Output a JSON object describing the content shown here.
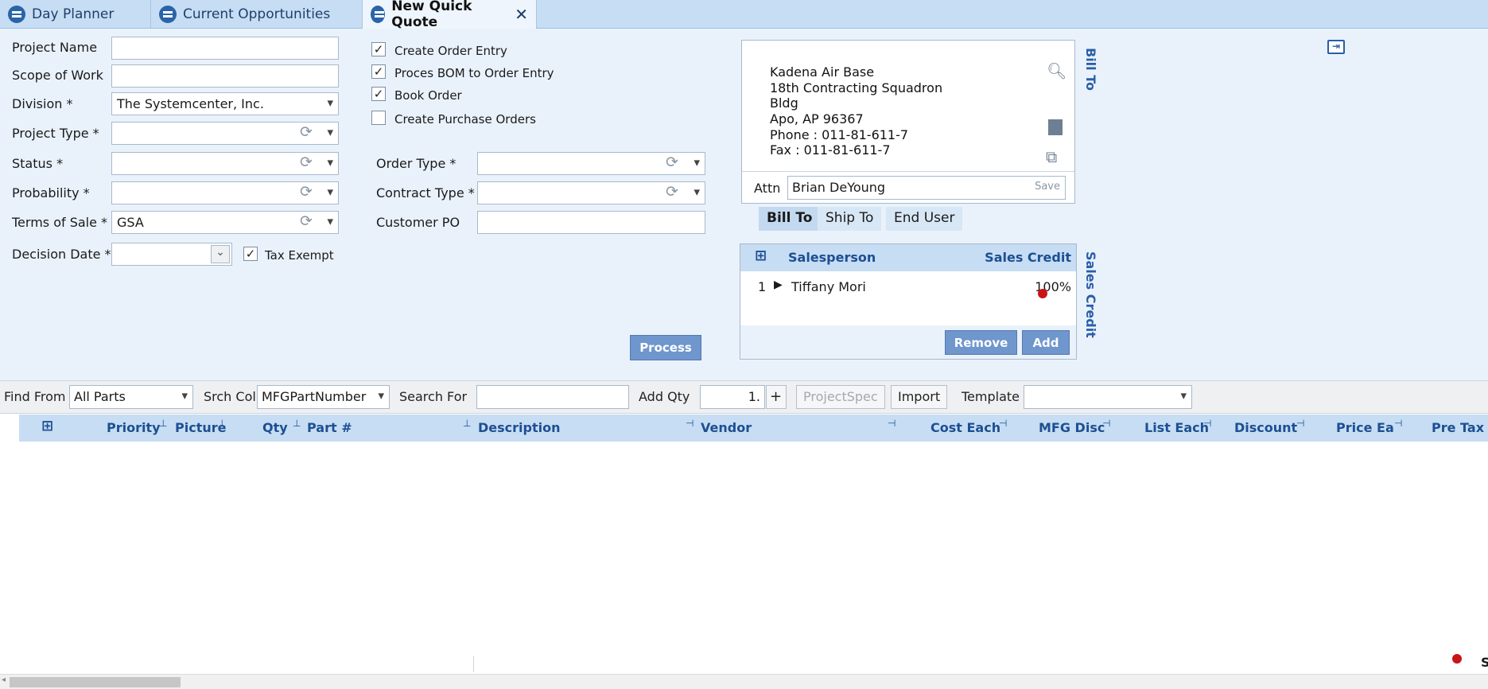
{
  "tabs": [
    {
      "label": "Day Planner",
      "active": false
    },
    {
      "label": "Current Opportunities",
      "active": false
    },
    {
      "label": "New Quick Quote",
      "active": true
    }
  ],
  "form": {
    "project_name": {
      "label": "Project Name",
      "value": ""
    },
    "scope_of_work": {
      "label": "Scope of Work",
      "value": ""
    },
    "division": {
      "label": "Division *",
      "value": "The Systemcenter, Inc."
    },
    "project_type": {
      "label": "Project Type *",
      "value": ""
    },
    "status": {
      "label": "Status *",
      "value": ""
    },
    "probability": {
      "label": "Probability *",
      "value": ""
    },
    "terms_of_sale": {
      "label": "Terms of Sale *",
      "value": "GSA"
    },
    "decision_date": {
      "label": "Decision Date *",
      "value": ""
    },
    "tax_exempt": {
      "label": "Tax Exempt",
      "checked": true
    }
  },
  "order_options": [
    {
      "label": "Create Order Entry",
      "checked": true
    },
    {
      "label": "Proces BOM to Order Entry",
      "checked": true
    },
    {
      "label": "Book Order",
      "checked": true
    },
    {
      "label": "Create Purchase Orders",
      "checked": false
    }
  ],
  "order": {
    "order_type": {
      "label": "Order Type *",
      "value": ""
    },
    "contract_type": {
      "label": "Contract Type *",
      "value": ""
    },
    "customer_po": {
      "label": "Customer PO",
      "value": ""
    },
    "process_label": "Process"
  },
  "bill_to": {
    "side_label": "Bill To",
    "lines": [
      "Kadena Air Base",
      "18th Contracting Squadron",
      "Bldg",
      "Apo, AP 96367",
      "Phone : 011-81-611-7",
      "Fax : 011-81-611-7"
    ],
    "attn_label": "Attn",
    "attn_value": "Brian DeYoung",
    "save_label": "Save",
    "subtabs": [
      "Bill To",
      "Ship To",
      "End User"
    ]
  },
  "sales": {
    "side_label": "Sales Credit",
    "headers": {
      "salesperson": "Salesperson",
      "credit": "Sales Credit"
    },
    "rows": [
      {
        "index": "1",
        "name": "Tiffany Mori",
        "credit": "100%"
      }
    ],
    "remove_label": "Remove",
    "add_label": "Add"
  },
  "toolbar": {
    "find_from_label": "Find From",
    "find_from_value": "All Parts",
    "srch_col_label": "Srch Col",
    "srch_col_value": "MFGPartNumber",
    "search_for_label": "Search For",
    "search_for_value": "",
    "add_qty_label": "Add Qty",
    "add_qty_value": "1.",
    "plus": "+",
    "projectspec_label": "ProjectSpec",
    "import_label": "Import",
    "template_label": "Template",
    "template_value": ""
  },
  "grid": {
    "columns": [
      "Priority",
      "Picture",
      "Qty",
      "Part #",
      "Description",
      "Vendor",
      "Cost Each",
      "MFG Disc",
      "List Each",
      "Discount",
      "Price Ea",
      "Pre Tax Su"
    ]
  },
  "footer_text": "S"
}
